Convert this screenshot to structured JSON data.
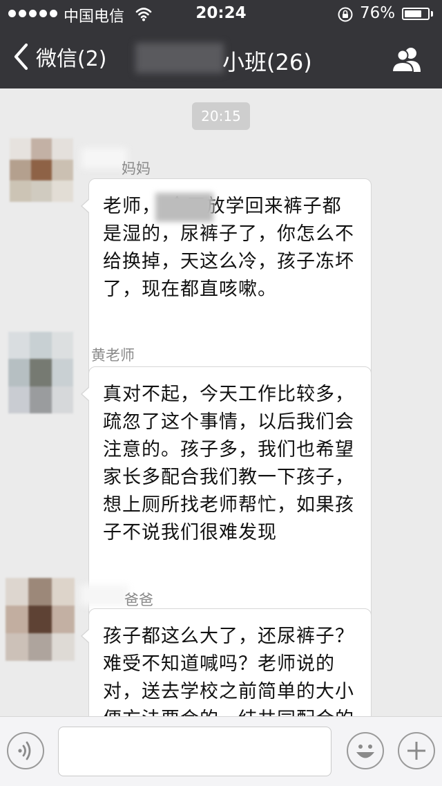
{
  "status_bar": {
    "carrier": "中国电信",
    "time": "20:24",
    "battery": "76%",
    "battery_level": 0.76
  },
  "nav": {
    "back_label": "微信(2)",
    "title": "小班(26)"
  },
  "chat": {
    "timestamp": "20:15",
    "messages": [
      {
        "sender": "妈妈",
        "text": "老师，        今天放学回来裤子都是湿的，尿裤子了，你怎么不给换掉，天这么冷，孩子冻坏了，现在都直咳嗽。"
      },
      {
        "sender": "黄老师",
        "text": "真对不起，今天工作比较多，疏忽了这个事情，以后我们会注意的。孩子多，我们也希望家长多配合我们教一下孩子，想上厕所找老师帮忙，如果孩子不说我们很难发现"
      },
      {
        "sender": "爸爸",
        "text": "孩子都这么大了，还尿裤子？难受不知道喊吗？老师说的对，送去学校之前简单的大小便方法要会的，结共同配合的"
      }
    ]
  },
  "input": {
    "placeholder": ""
  },
  "colors": {
    "nav_bg": "#353539",
    "chat_bg": "#ebebeb",
    "bubble_bg": "#ffffff"
  }
}
